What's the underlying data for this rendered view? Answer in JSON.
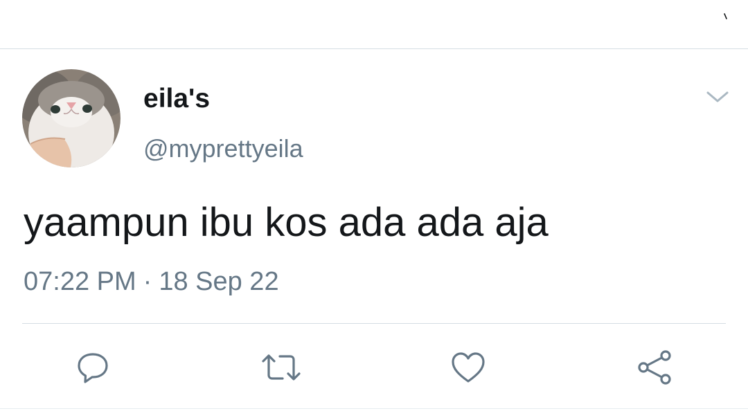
{
  "tweet": {
    "author": {
      "display_name": "eila's",
      "handle": "@myprettyeila",
      "avatar_icon": "cat-avatar"
    },
    "text": "yaampun ibu kos ada ada aja",
    "time": "07:22 PM",
    "separator": "·",
    "date": "18 Sep 22"
  },
  "actions": [
    {
      "name": "reply",
      "icon": "reply-icon"
    },
    {
      "name": "retweet",
      "icon": "retweet-icon"
    },
    {
      "name": "like",
      "icon": "heart-icon"
    },
    {
      "name": "share",
      "icon": "share-icon"
    }
  ],
  "colors": {
    "text": "#14171a",
    "secondary": "#657786",
    "divider": "#d5dde3",
    "icon": "#657786"
  }
}
